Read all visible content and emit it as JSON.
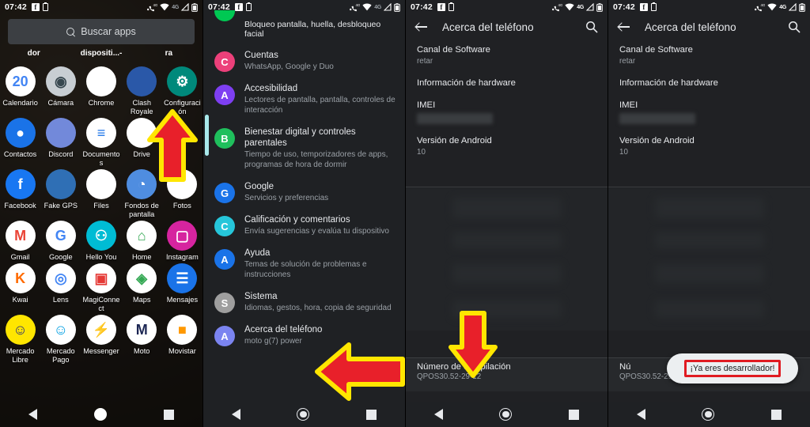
{
  "statusbar": {
    "time": "07:42",
    "icons": [
      "facebook-icon",
      "battery-saver-icon",
      "missed-call-4g-icon",
      "wifi-icon",
      "4g-text",
      "signal-icon",
      "battery-icon"
    ],
    "network_label": "4G"
  },
  "panel1": {
    "name": "app-drawer",
    "search": {
      "placeholder": "Buscar apps",
      "icon": "search-icon"
    },
    "cut_labels": [
      "dor",
      "dispositi...-",
      "ra"
    ],
    "apps": [
      [
        {
          "label": "Calendario",
          "icon": "calendar-icon",
          "glyph": "20",
          "bg": "#ffffff",
          "fg": "#4285f4"
        },
        {
          "label": "Cámara",
          "icon": "camera-icon",
          "glyph": "◉",
          "bg": "#c8ced3",
          "fg": "#37474f"
        },
        {
          "label": "Chrome",
          "icon": "chrome-icon",
          "glyph": "",
          "bg": "#ffffff",
          "fg": "#4285f4"
        },
        {
          "label": "Clash Royale",
          "icon": "clash-royale-icon",
          "glyph": "",
          "bg": "#2a58a8",
          "fg": "#ffffff"
        },
        {
          "label": "Configuración",
          "icon": "settings-gear-icon",
          "glyph": "⚙",
          "bg": "#00897b",
          "fg": "#ffffff"
        }
      ],
      [
        {
          "label": "Contactos",
          "icon": "contacts-icon",
          "glyph": "●",
          "bg": "#1a73e8",
          "fg": "#ffffff"
        },
        {
          "label": "Discord",
          "icon": "discord-icon",
          "glyph": "",
          "bg": "#7289da",
          "fg": "#ffffff"
        },
        {
          "label": "Documentos",
          "icon": "docs-icon",
          "glyph": "≡",
          "bg": "#ffffff",
          "fg": "#1a73e8"
        },
        {
          "label": "Drive",
          "icon": "drive-icon",
          "glyph": "",
          "bg": "#ffffff",
          "fg": "#0f9d58"
        },
        {
          "label": "",
          "icon": "",
          "glyph": "",
          "bg": "transparent",
          "fg": "transparent"
        }
      ],
      [
        {
          "label": "Facebook",
          "icon": "facebook-icon",
          "glyph": "f",
          "bg": "#1877f2",
          "fg": "#ffffff"
        },
        {
          "label": "Fake GPS",
          "icon": "fake-gps-icon",
          "glyph": "",
          "bg": "#2f6fb5",
          "fg": "#ffffff"
        },
        {
          "label": "Files",
          "icon": "files-icon",
          "glyph": "",
          "bg": "#ffffff",
          "fg": "#4285f4"
        },
        {
          "label": "Fondos de pantalla",
          "icon": "wallpaper-icon",
          "glyph": "◔",
          "bg": "#4f8de0",
          "fg": "#ffffff"
        },
        {
          "label": "Fotos",
          "icon": "photos-icon",
          "glyph": "",
          "bg": "#ffffff",
          "fg": "#ea4335"
        }
      ],
      [
        {
          "label": "Gmail",
          "icon": "gmail-icon",
          "glyph": "M",
          "bg": "#ffffff",
          "fg": "#ea4335"
        },
        {
          "label": "Google",
          "icon": "google-icon",
          "glyph": "G",
          "bg": "#ffffff",
          "fg": "#4285f4"
        },
        {
          "label": "Hello You",
          "icon": "hello-you-icon",
          "glyph": "⚇",
          "bg": "#00bcd4",
          "fg": "#ffffff"
        },
        {
          "label": "Home",
          "icon": "home-icon",
          "glyph": "⌂",
          "bg": "#ffffff",
          "fg": "#34a853"
        },
        {
          "label": "Instagram",
          "icon": "instagram-icon",
          "glyph": "▢",
          "bg": "#d6249f",
          "fg": "#ffffff"
        }
      ],
      [
        {
          "label": "Kwai",
          "icon": "kwai-icon",
          "glyph": "K",
          "bg": "#ffffff",
          "fg": "#ff6a00"
        },
        {
          "label": "Lens",
          "icon": "lens-icon",
          "glyph": "◎",
          "bg": "#ffffff",
          "fg": "#4285f4"
        },
        {
          "label": "MagiConnect",
          "icon": "magiconnect-icon",
          "glyph": "▣",
          "bg": "#ffffff",
          "fg": "#e53935"
        },
        {
          "label": "Maps",
          "icon": "maps-icon",
          "glyph": "◈",
          "bg": "#ffffff",
          "fg": "#34a853"
        },
        {
          "label": "Mensajes",
          "icon": "messages-icon",
          "glyph": "☰",
          "bg": "#1a73e8",
          "fg": "#ffffff"
        }
      ],
      [
        {
          "label": "Mercado Libre",
          "icon": "mercado-libre-icon",
          "glyph": "☺",
          "bg": "#ffe600",
          "fg": "#2d3277"
        },
        {
          "label": "Mercado Pago",
          "icon": "mercado-pago-icon",
          "glyph": "☺",
          "bg": "#ffffff",
          "fg": "#009ee3"
        },
        {
          "label": "Messenger",
          "icon": "messenger-icon",
          "glyph": "⚡",
          "bg": "#ffffff",
          "fg": "#a033ff"
        },
        {
          "label": "Moto",
          "icon": "moto-icon",
          "glyph": "M",
          "bg": "#ffffff",
          "fg": "#1c2653"
        },
        {
          "label": "Movistar",
          "icon": "movistar-icon",
          "glyph": "■",
          "bg": "#ffffff",
          "fg": "#ff9800"
        }
      ]
    ],
    "arrow": {
      "name": "up-arrow-annotation",
      "direction": "up",
      "fill": "#e8202a",
      "stroke": "#ffe600"
    }
  },
  "panel2": {
    "name": "settings-list",
    "partial_top": "Bloqueo pantalla, huella, desbloqueo facial",
    "items": [
      {
        "title": "Cuentas",
        "sub": "WhatsApp, Google y Duo",
        "icon": "accounts-icon",
        "bg": "#ec407a"
      },
      {
        "title": "Accesibilidad",
        "sub": "Lectores de pantalla, pantalla, controles de interacción",
        "icon": "accessibility-icon",
        "bg": "#7e3ff2"
      },
      {
        "title": "Bienestar digital y controles parentales",
        "sub": "Tiempo de uso, temporizadores de apps, programas de hora de dormir",
        "icon": "digital-wellbeing-icon",
        "bg": "#1fbf5c"
      },
      {
        "title": "Google",
        "sub": "Servicios y preferencias",
        "icon": "google-icon",
        "bg": "#1a73e8"
      },
      {
        "title": "Calificación y comentarios",
        "sub": "Envía sugerencias y evalúa tu dispositivo",
        "icon": "feedback-icon",
        "bg": "#26c6da"
      },
      {
        "title": "Ayuda",
        "sub": "Temas de solución de problemas e instrucciones",
        "icon": "help-icon",
        "bg": "#1a73e8"
      },
      {
        "title": "Sistema",
        "sub": "Idiomas, gestos, hora, copia de seguridad",
        "icon": "system-info-icon",
        "bg": "#9e9e9e"
      },
      {
        "title": "Acerca del teléfono",
        "sub": "moto g(7) power",
        "icon": "about-phone-icon",
        "bg": "#7b84f0"
      }
    ],
    "arrow": {
      "name": "left-arrow-annotation",
      "direction": "left",
      "fill": "#e8202a",
      "stroke": "#ffe600"
    },
    "scrollbar": "scroll-thumb"
  },
  "panel3": {
    "name": "about-phone-screen",
    "appbar": {
      "title": "Acerca del teléfono",
      "back_icon": "back-arrow-icon",
      "search_icon": "search-icon"
    },
    "rows": [
      {
        "key": "Canal de Software",
        "value": "retar"
      },
      {
        "key": "Información de hardware",
        "value": ""
      },
      {
        "key": "IMEI",
        "value": "",
        "redacted": true
      },
      {
        "key": "Versión de Android",
        "value": "10"
      }
    ],
    "build_row": {
      "key": "Número de compilación",
      "value": "QPOS30.52-29-12"
    },
    "arrow": {
      "name": "down-arrow-annotation",
      "direction": "down",
      "fill": "#e8202a",
      "stroke": "#ffe600"
    }
  },
  "panel4": {
    "name": "about-phone-screen-toast",
    "appbar": {
      "title": "Acerca del teléfono",
      "back_icon": "back-arrow-icon",
      "search_icon": "search-icon"
    },
    "rows": [
      {
        "key": "Canal de Software",
        "value": "retar"
      },
      {
        "key": "Información de hardware",
        "value": ""
      },
      {
        "key": "IMEI",
        "value": "",
        "redacted": true
      },
      {
        "key": "Versión de Android",
        "value": "10"
      }
    ],
    "build_row": {
      "key": "Nú",
      "value": "QPOS30.52-29-12"
    },
    "toast": {
      "text": "¡Ya eres desarrollador!",
      "highlight_color": "#e01b22",
      "bg": "#eceff1"
    }
  },
  "navbar": {
    "back": "nav-back-icon",
    "home": "nav-home-icon",
    "recents": "nav-recents-icon"
  }
}
